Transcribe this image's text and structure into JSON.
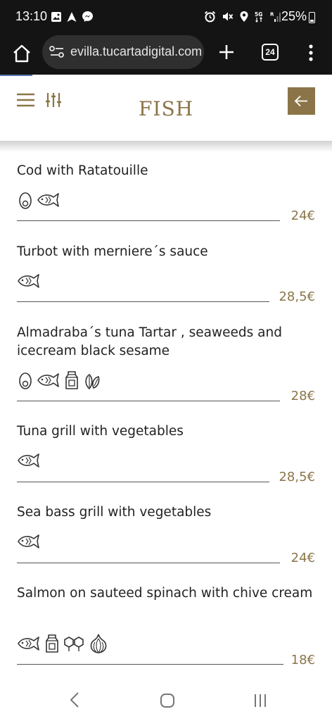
{
  "status_bar": {
    "time": "13:10",
    "battery": "25%",
    "icons_left": [
      "image-icon",
      "navigation-arrow-icon",
      "messenger-icon"
    ],
    "icons_right": [
      "alarm-icon",
      "mute-icon",
      "location-icon",
      "5g-icon",
      "signal-icon"
    ]
  },
  "browser": {
    "url": "evilla.tucartadigital.com",
    "tab_count": "24"
  },
  "header": {
    "title": "FISH"
  },
  "colors": {
    "accent": "#8b7548"
  },
  "items": [
    {
      "name": "Cod with Ratatouille",
      "price": "24€",
      "allergens": [
        "egg-icon",
        "fish-icon"
      ]
    },
    {
      "name": "Turbot with merniere´s sauce",
      "price": "28,5€",
      "allergens": [
        "fish-icon"
      ]
    },
    {
      "name": "Almadraba´s tuna Tartar , seaweeds and icecream black sesame",
      "price": "28€",
      "allergens": [
        "egg-icon",
        "fish-icon",
        "milk-icon",
        "soy-icon"
      ]
    },
    {
      "name": "Tuna grill with vegetables",
      "price": "28,5€",
      "allergens": [
        "fish-icon"
      ]
    },
    {
      "name": "Sea bass grill with vegetables",
      "price": "24€",
      "allergens": [
        "fish-icon"
      ]
    },
    {
      "name": "Salmon on sauteed spinach with chive cream",
      "price": "18€",
      "allergens": [
        "fish-icon",
        "milk-icon",
        "sulphites-icon",
        "garlic-icon"
      ]
    }
  ]
}
